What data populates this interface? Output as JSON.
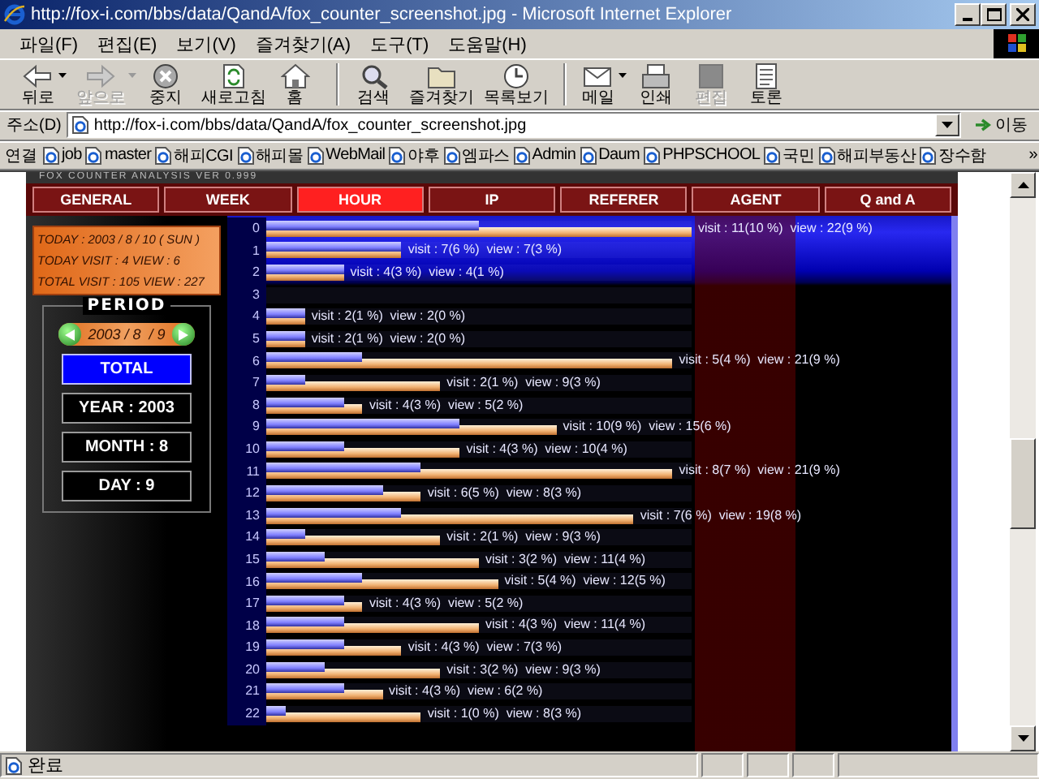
{
  "window": {
    "title": "http://fox-i.com/bbs/data/QandA/fox_counter_screenshot.jpg - Microsoft Internet Explorer"
  },
  "menu": [
    "파일(F)",
    "편집(E)",
    "보기(V)",
    "즐겨찾기(A)",
    "도구(T)",
    "도움말(H)"
  ],
  "toolbar": [
    [
      {
        "kind": "back",
        "label": "뒤로",
        "disabled": false,
        "dropdown": true
      },
      {
        "kind": "forward",
        "label": "앞으로",
        "disabled": true,
        "dropdown": true
      },
      {
        "kind": "stop",
        "label": "중지",
        "disabled": false,
        "dropdown": false
      },
      {
        "kind": "refresh",
        "label": "새로고침",
        "disabled": false,
        "dropdown": false
      },
      {
        "kind": "home",
        "label": "홈",
        "disabled": false,
        "dropdown": false
      }
    ],
    [
      {
        "kind": "search",
        "label": "검색",
        "disabled": false,
        "dropdown": false
      },
      {
        "kind": "favorites",
        "label": "즐겨찾기",
        "disabled": false,
        "dropdown": false
      },
      {
        "kind": "history",
        "label": "목록보기",
        "disabled": false,
        "dropdown": false
      }
    ],
    [
      {
        "kind": "mail",
        "label": "메일",
        "disabled": false,
        "dropdown": true
      },
      {
        "kind": "print",
        "label": "인쇄",
        "disabled": false,
        "dropdown": false
      },
      {
        "kind": "edit",
        "label": "편집",
        "disabled": true,
        "dropdown": false
      },
      {
        "kind": "discuss",
        "label": "토론",
        "disabled": false,
        "dropdown": false
      }
    ]
  ],
  "address": {
    "label": "주소(D)",
    "value": "http://fox-i.com/bbs/data/QandA/fox_counter_screenshot.jpg",
    "go": "이동"
  },
  "links": {
    "label": "연결",
    "items": [
      "job",
      "master",
      "해피CGI",
      "해피몰",
      "WebMail",
      "야후",
      "엠파스",
      "Admin",
      "Daum",
      "PHPSCHOOL",
      "국민",
      "해피부동산",
      "장수함"
    ],
    "more": "»"
  },
  "page": {
    "header": "FOX COUNTER ANALYSIS VER 0.999",
    "tabs": [
      {
        "label": "GENERAL",
        "selected": false
      },
      {
        "label": "WEEK",
        "selected": false
      },
      {
        "label": "HOUR",
        "selected": true
      },
      {
        "label": "IP",
        "selected": false
      },
      {
        "label": "REFERER",
        "selected": false
      },
      {
        "label": "AGENT",
        "selected": false
      },
      {
        "label": "Q and A",
        "selected": false
      }
    ],
    "info": [
      "TODAY : 2003 / 8 / 10 ( SUN )",
      "TODAY VISIT : 4 VIEW : 6",
      "TOTAL VISIT : 105 VIEW : 227"
    ],
    "period": {
      "title": "PERIOD",
      "date": "2003 / 8  / 9",
      "buttons": [
        {
          "label": "TOTAL",
          "selected": true
        },
        {
          "label": "YEAR : 2003",
          "selected": false
        },
        {
          "label": "MONTH : 8",
          "selected": false
        },
        {
          "label": "DAY : 9",
          "selected": false
        }
      ]
    },
    "hours": [
      {
        "hour": "0",
        "visit": {
          "level": 0.5
        },
        "view": {
          "level": 1
        },
        "reading": "visit : 11(10 %)  view : 22(9 %)"
      },
      {
        "hour": "1",
        "visit": {
          "level": 0.318
        },
        "view": {
          "level": 0.318
        },
        "reading": "visit : 7(6 %)  view : 7(3 %)"
      },
      {
        "hour": "2",
        "visit": {
          "level": 0.182
        },
        "view": {
          "level": 0.182
        },
        "reading": "visit : 4(3 %)  view : 4(1 %)"
      },
      {
        "hour": "3",
        "visit": {
          "level": 0
        },
        "view": {
          "level": 0
        }
      },
      {
        "hour": "4",
        "visit": {
          "level": 0.091
        },
        "view": {
          "level": 0.091
        },
        "reading": "visit : 2(1 %)  view : 2(0 %)"
      },
      {
        "hour": "5",
        "visit": {
          "level": 0.091
        },
        "view": {
          "level": 0.091
        },
        "reading": "visit : 2(1 %)  view : 2(0 %)"
      },
      {
        "hour": "6",
        "visit": {
          "level": 0.227
        },
        "view": {
          "level": 0.955
        },
        "reading": "visit : 5(4 %)  view : 21(9 %)"
      },
      {
        "hour": "7",
        "visit": {
          "level": 0.091
        },
        "view": {
          "level": 0.409
        },
        "reading": "visit : 2(1 %)  view : 9(3 %)"
      },
      {
        "hour": "8",
        "visit": {
          "level": 0.182
        },
        "view": {
          "level": 0.227
        },
        "reading": "visit : 4(3 %)  view : 5(2 %)"
      },
      {
        "hour": "9",
        "visit": {
          "level": 0.455
        },
        "view": {
          "level": 0.682
        },
        "reading": "visit : 10(9 %)  view : 15(6 %)"
      },
      {
        "hour": "10",
        "visit": {
          "level": 0.182
        },
        "view": {
          "level": 0.455
        },
        "reading": "visit : 4(3 %)  view : 10(4 %)"
      },
      {
        "hour": "11",
        "visit": {
          "level": 0.364
        },
        "view": {
          "level": 0.955
        },
        "reading": "visit : 8(7 %)  view : 21(9 %)"
      },
      {
        "hour": "12",
        "visit": {
          "level": 0.273
        },
        "view": {
          "level": 0.364
        },
        "reading": "visit : 6(5 %)  view : 8(3 %)"
      },
      {
        "hour": "13",
        "visit": {
          "level": 0.318
        },
        "view": {
          "level": 0.864
        },
        "reading": "visit : 7(6 %)  view : 19(8 %)"
      },
      {
        "hour": "14",
        "visit": {
          "level": 0.091
        },
        "view": {
          "level": 0.409
        },
        "reading": "visit : 2(1 %)  view : 9(3 %)"
      },
      {
        "hour": "15",
        "visit": {
          "level": 0.136
        },
        "view": {
          "level": 0.5
        },
        "reading": "visit : 3(2 %)  view : 11(4 %)"
      },
      {
        "hour": "16",
        "visit": {
          "level": 0.227
        },
        "view": {
          "level": 0.545
        },
        "reading": "visit : 5(4 %)  view : 12(5 %)"
      },
      {
        "hour": "17",
        "visit": {
          "level": 0.182
        },
        "view": {
          "level": 0.227
        },
        "reading": "visit : 4(3 %)  view : 5(2 %)"
      },
      {
        "hour": "18",
        "visit": {
          "level": 0.182
        },
        "view": {
          "level": 0.5
        },
        "reading": "visit : 4(3 %)  view : 11(4 %)"
      },
      {
        "hour": "19",
        "visit": {
          "level": 0.182
        },
        "view": {
          "level": 0.318
        },
        "reading": "visit : 4(3 %)  view : 7(3 %)"
      },
      {
        "hour": "20",
        "visit": {
          "level": 0.136
        },
        "view": {
          "level": 0.409
        },
        "reading": "visit : 3(2 %)  view : 9(3 %)"
      },
      {
        "hour": "21",
        "visit": {
          "level": 0.182
        },
        "view": {
          "level": 0.273
        },
        "reading": "visit : 4(3 %)  view : 6(2 %)"
      },
      {
        "hour": "22",
        "visit": {
          "level": 0.045
        },
        "view": {
          "level": 0.364
        },
        "reading": "visit : 1(0 %)  view : 8(3 %)"
      }
    ]
  },
  "status": {
    "text": "완료"
  }
}
